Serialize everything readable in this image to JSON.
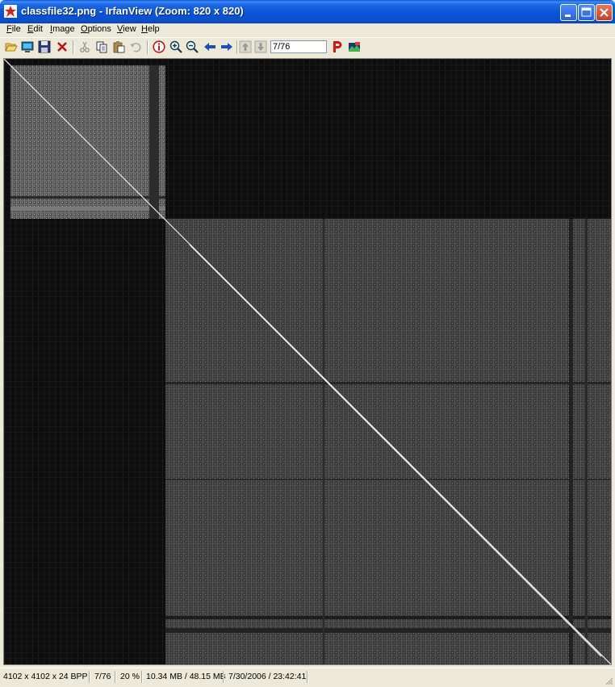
{
  "window": {
    "title": "classfile32.png - IrfanView (Zoom: 820 x 820)"
  },
  "menu": {
    "items": [
      {
        "pre": "",
        "key": "F",
        "post": "ile"
      },
      {
        "pre": "",
        "key": "E",
        "post": "dit"
      },
      {
        "pre": "",
        "key": "I",
        "post": "mage"
      },
      {
        "pre": "",
        "key": "O",
        "post": "ptions"
      },
      {
        "pre": "",
        "key": "V",
        "post": "iew"
      },
      {
        "pre": "",
        "key": "H",
        "post": "elp"
      }
    ]
  },
  "toolbar": {
    "page_value": "7/76",
    "icons": [
      "open-folder-icon",
      "slideshow-icon",
      "save-icon",
      "delete-icon",
      "cut-icon",
      "copy-icon",
      "paste-icon",
      "undo-icon",
      "info-icon",
      "zoom-in-icon",
      "zoom-out-icon",
      "previous-arrow-icon",
      "next-arrow-icon",
      "first-page-icon",
      "last-page-icon",
      "print-p-icon",
      "thumbnails-icon"
    ]
  },
  "colors": {
    "title_blue": "#0854d7",
    "close_red": "#c9401f",
    "face_gray": "#ece9d8",
    "image_dark_gray": "#3e3e3e",
    "image_black": "#0c0c0c"
  },
  "status": {
    "dimensions": "4102 x 4102 x 24 BPP",
    "page": "7/76",
    "zoom": "20 %",
    "memory": "10.34 MB / 48.15 MB",
    "datetime": "7/30/2006 / 23:42:41"
  }
}
